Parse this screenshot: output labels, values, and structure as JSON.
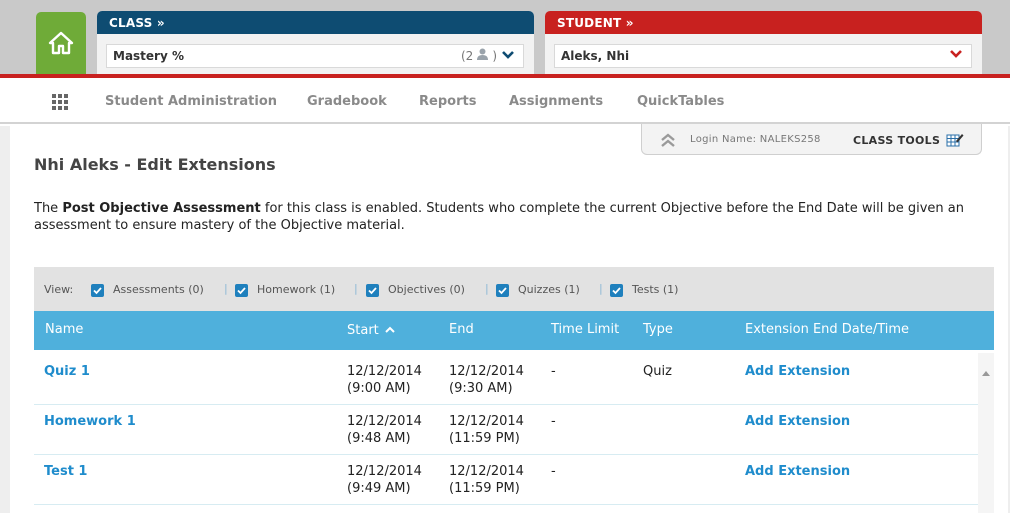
{
  "header": {
    "class_label": "CLASS »",
    "class_selected": "Mastery %",
    "class_count": "(2",
    "class_count_close": ")",
    "student_label": "STUDENT »",
    "student_selected": "Aleks, Nhi"
  },
  "nav": {
    "items": [
      "Student Administration",
      "Gradebook",
      "Reports",
      "Assignments",
      "QuickTables"
    ]
  },
  "login": {
    "label": "Login Name: NALEKS258",
    "tools_label": "CLASS TOOLS"
  },
  "page": {
    "title": "Nhi Aleks - Edit Extensions",
    "info_prefix": "The ",
    "info_bold": "Post Objective Assessment",
    "info_suffix": " for this class is enabled. Students who complete the current Objective before the End Date will be given an assessment to ensure mastery of the Objective material."
  },
  "filters": {
    "view_label": "View:",
    "items": [
      "Assessments (0)",
      "Homework (1)",
      "Objectives (0)",
      "Quizzes (1)",
      "Tests (1)"
    ],
    "separator": "|"
  },
  "table": {
    "headers": [
      "Name",
      "Start",
      "End",
      "Time Limit",
      "Type",
      "Extension End Date/Time"
    ],
    "rows": [
      {
        "name": "Quiz 1",
        "start_date": "12/12/2014",
        "start_time": "(9:00 AM)",
        "end_date": "12/12/2014",
        "end_time": "(9:30 AM)",
        "time_limit": "-",
        "type": "Quiz",
        "extension": "Add Extension"
      },
      {
        "name": "Homework 1",
        "start_date": "12/12/2014",
        "start_time": "(9:48 AM)",
        "end_date": "12/12/2014",
        "end_time": "(11:59 PM)",
        "time_limit": "-",
        "type": "",
        "extension": "Add Extension"
      },
      {
        "name": "Test 1",
        "start_date": "12/12/2014",
        "start_time": "(9:49 AM)",
        "end_date": "12/12/2014",
        "end_time": "(11:59 PM)",
        "time_limit": "-",
        "type": "",
        "extension": "Add Extension"
      }
    ]
  },
  "colors": {
    "class_header": "#0e4c72",
    "student_header": "#c8211f",
    "home": "#6fab38",
    "table_header": "#4fb0dc",
    "link": "#1f8ccc"
  },
  "icons": [
    "home-icon",
    "user-icon",
    "chevron-down-icon",
    "grid-menu-icon",
    "double-chevron-up-icon",
    "edit-table-icon",
    "sort-asc-icon",
    "scroll-up-icon"
  ]
}
